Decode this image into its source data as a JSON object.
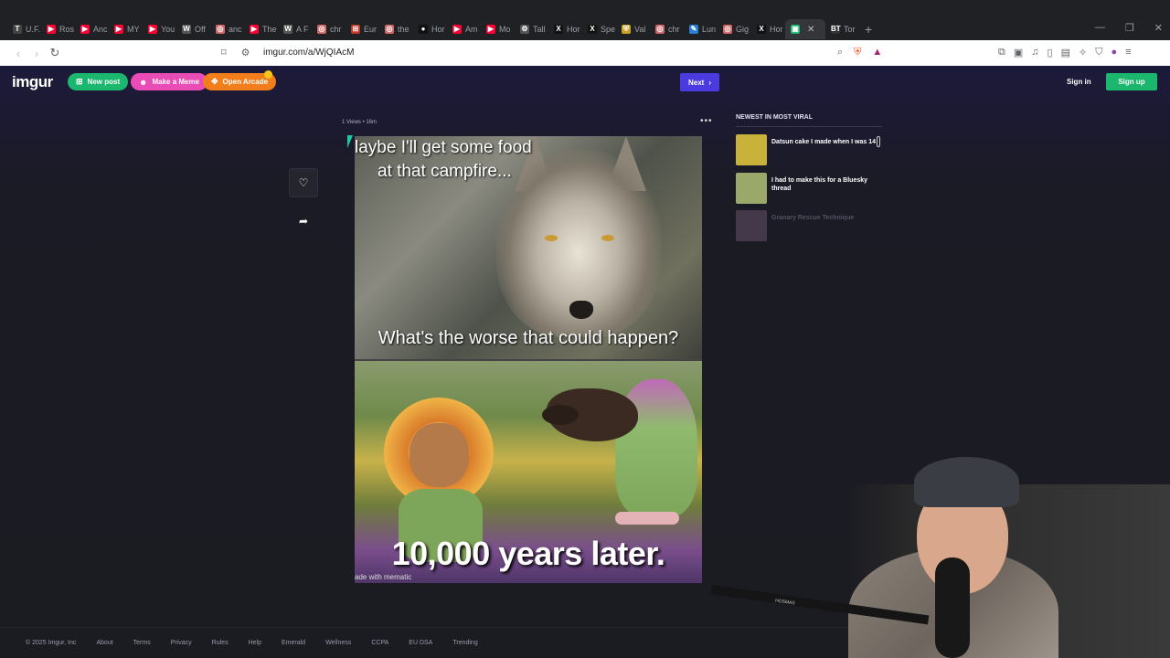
{
  "browser": {
    "tabs": [
      {
        "label": "U.F.",
        "icon": "news-icon",
        "color": "#444444",
        "glyph": "T"
      },
      {
        "label": "Ros",
        "icon": "youtube-icon",
        "color": "#ff0033",
        "glyph": "▶"
      },
      {
        "label": "Anc",
        "icon": "youtube-icon",
        "color": "#ff0033",
        "glyph": "▶"
      },
      {
        "label": "MY",
        "icon": "youtube-icon",
        "color": "#ff0033",
        "glyph": "▶"
      },
      {
        "label": "You",
        "icon": "youtube-icon",
        "color": "#ff0033",
        "glyph": "▶"
      },
      {
        "label": "Off",
        "icon": "wikipedia-icon",
        "color": "#555555",
        "glyph": "W"
      },
      {
        "label": "anc",
        "icon": "search-tab-icon",
        "color": "#d06a6a",
        "glyph": "◎"
      },
      {
        "label": "The",
        "icon": "youtube-icon",
        "color": "#ff0033",
        "glyph": "▶"
      },
      {
        "label": "A F",
        "icon": "wikipedia-icon",
        "color": "#555555",
        "glyph": "W"
      },
      {
        "label": "chr",
        "icon": "search-tab-icon",
        "color": "#d06a6a",
        "glyph": "◎"
      },
      {
        "label": "Eur",
        "icon": "flag-icon",
        "color": "#c0392b",
        "glyph": "⊞"
      },
      {
        "label": "the",
        "icon": "search-tab-icon",
        "color": "#d06a6a",
        "glyph": "◎"
      },
      {
        "label": "Hor",
        "icon": "github-icon",
        "color": "#111111",
        "glyph": "●"
      },
      {
        "label": "Am",
        "icon": "youtube-icon",
        "color": "#ff0033",
        "glyph": "▶"
      },
      {
        "label": "Mo",
        "icon": "youtube-icon",
        "color": "#ff0033",
        "glyph": "▶"
      },
      {
        "label": "Tall",
        "icon": "gear-tab-icon",
        "color": "#555555",
        "glyph": "⚙"
      },
      {
        "label": "Hor",
        "icon": "x-icon",
        "color": "#111111",
        "glyph": "X"
      },
      {
        "label": "Spe",
        "icon": "x-icon",
        "color": "#111111",
        "glyph": "X"
      },
      {
        "label": "Val",
        "icon": "shield-tab-icon",
        "color": "#c9a227",
        "glyph": "⛨"
      },
      {
        "label": "chr",
        "icon": "search-tab-icon",
        "color": "#d06a6a",
        "glyph": "◎"
      },
      {
        "label": "Lun",
        "icon": "feather-icon",
        "color": "#2a7fd4",
        "glyph": "✎"
      },
      {
        "label": "Gig",
        "icon": "search-tab-icon",
        "color": "#d06a6a",
        "glyph": "◎"
      },
      {
        "label": "Hor",
        "icon": "x-icon",
        "color": "#111111",
        "glyph": "X"
      },
      {
        "label": "",
        "icon": "imgur-icon",
        "color": "#1bb76e",
        "glyph": "▣",
        "active": true
      },
      {
        "label": "Tor",
        "icon": "bt-icon",
        "color": "#333333",
        "glyph": "BT"
      }
    ],
    "new_tab": "+",
    "url": "imgur.com/a/WjQIAcM"
  },
  "imgur": {
    "logo": "imgur",
    "new_post": "New post",
    "make_meme": "Make a Meme",
    "open_arcade": "Open Arcade",
    "next": "Next",
    "sign_in": "Sign in",
    "sign_up": "Sign up",
    "post_meta": "1 Views • 16m",
    "more": "•••",
    "meme": {
      "top_line1": "Maybe I'll get some food",
      "top_line1_visible": "laybe I'll get some food",
      "top_line2": "at that campfire...",
      "middle": "What's the worse that could happen?",
      "bottom": "10,000 years later.",
      "watermark": "ade with mematic"
    },
    "rail": {
      "title": "NEWEST IN MOST VIRAL",
      "items": [
        {
          "title": "Datsun cake I made when I was 14",
          "thumb_color": "#c9b23a"
        },
        {
          "title": "I had to make this for a Bluesky thread",
          "thumb_color": "#9aa96a"
        },
        {
          "title": "Granary Rescue Technique",
          "thumb_color": "#5a4a5e"
        }
      ]
    },
    "footer": [
      "© 2025 Imgur, Inc",
      "About",
      "Terms",
      "Privacy",
      "Rules",
      "Help",
      "Emerald",
      "Wellness",
      "CCPA",
      "EU DSA",
      "Trending"
    ]
  },
  "webcam": {
    "mic_label": "HOSMAS"
  },
  "colors": {
    "accent_green": "#1bb76e",
    "accent_pink": "#ea4cb6",
    "accent_orange": "#f27d1b",
    "next_blue": "#4a3adf"
  }
}
